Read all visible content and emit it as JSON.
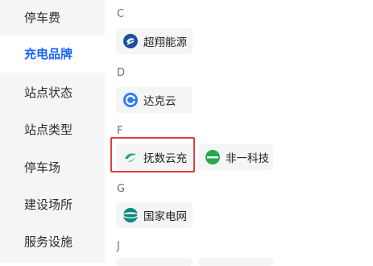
{
  "sidebar": {
    "items": [
      {
        "label": "停车费",
        "active": false
      },
      {
        "label": "充电品牌",
        "active": true
      },
      {
        "label": "站点状态",
        "active": false
      },
      {
        "label": "站点类型",
        "active": false
      },
      {
        "label": "停车场",
        "active": false
      },
      {
        "label": "建设场所",
        "active": false
      },
      {
        "label": "服务设施",
        "active": false
      }
    ]
  },
  "groups": [
    {
      "letter": "C",
      "brands": [
        {
          "label": "超翔能源",
          "icon": "chaoxiang-logo-icon"
        }
      ]
    },
    {
      "letter": "D",
      "brands": [
        {
          "label": "达克云",
          "icon": "dakeyun-logo-icon"
        }
      ]
    },
    {
      "letter": "F",
      "brands": [
        {
          "label": "抚数云充",
          "icon": "fushu-logo-icon",
          "selected": true
        },
        {
          "label": "非一科技",
          "icon": "feiyi-logo-icon"
        }
      ]
    },
    {
      "letter": "G",
      "brands": [
        {
          "label": "国家电网",
          "icon": "state-grid-logo-icon"
        }
      ]
    },
    {
      "letter": "J",
      "brands": []
    }
  ],
  "colors": {
    "accent": "#1a63ff",
    "highlight": "#e23b3b",
    "sidebar_bg": "#f4f5f7"
  }
}
